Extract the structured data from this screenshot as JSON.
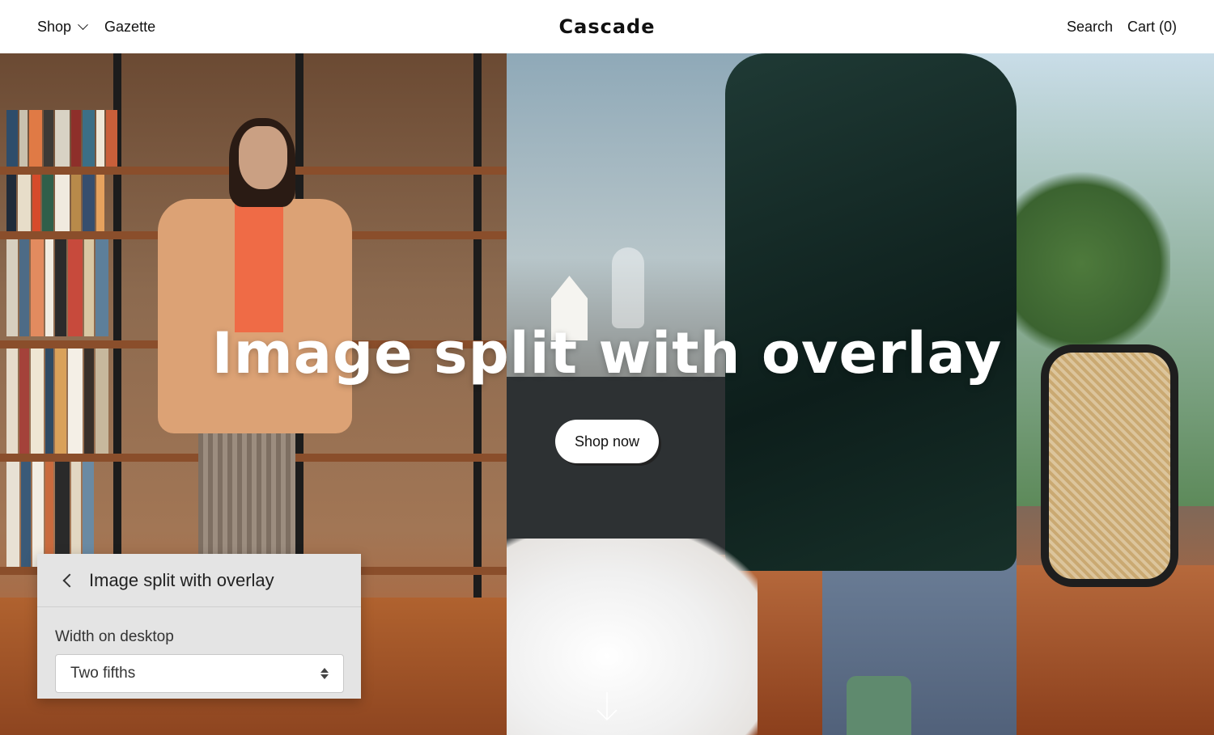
{
  "header": {
    "logo": "Cascade",
    "nav_left": [
      {
        "label": "Shop"
      },
      {
        "label": "Gazette"
      }
    ],
    "search_label": "Search",
    "cart_label": "Cart (0)"
  },
  "hero": {
    "title": "Image split with overlay",
    "button_label": "Shop now",
    "scroll_icon": "arrow-down-icon"
  },
  "settings_panel": {
    "title": "Image split with overlay",
    "field_label": "Width on desktop",
    "select_value": "Two fifths",
    "back_icon": "chevron-left-icon",
    "select_icon": "up-down-chevron-icon"
  },
  "colors": {
    "button_bg": "#ffffff",
    "panel_bg": "#e4e4e4",
    "title_color": "#ffffff"
  }
}
